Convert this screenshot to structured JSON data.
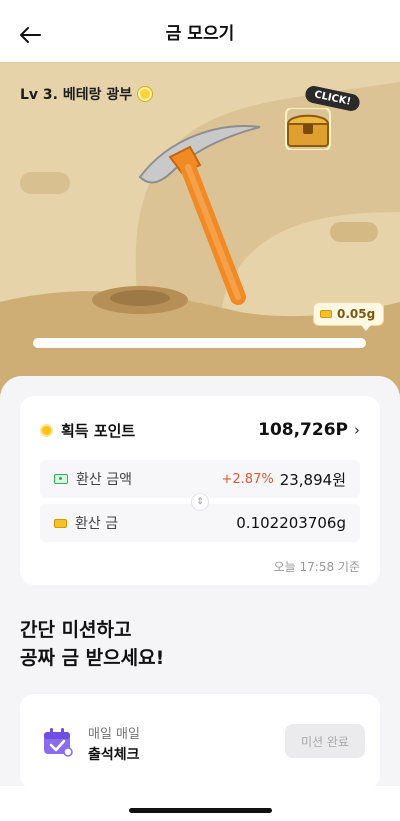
{
  "header": {
    "title": "금 모으기",
    "back_icon": "back-arrow-icon"
  },
  "hero": {
    "level_text": "Lv 3. 베테랑 광부",
    "click_badge": "CLICK!",
    "gold_amount": "0.05g",
    "colors": {
      "sand": "#e6d3aa",
      "path": "#d8bf8c",
      "ground": "#cba86d"
    }
  },
  "points": {
    "label": "획득 포인트",
    "value": "108,726P",
    "exchange": {
      "cash_label": "환산 금액",
      "cash_rate": "+2.87%",
      "cash_value": "23,894원",
      "gold_label": "환산 금",
      "gold_value": "0.102203706g"
    },
    "timestamp": "오늘 17:58 기준"
  },
  "missions": {
    "heading_line1": "간단 미션하고",
    "heading_line2": "공짜 금 받으세요!",
    "items": [
      {
        "subtitle": "매일 매일",
        "title": "출석체크",
        "button": "미션 완료",
        "icon": "calendar-check-icon"
      }
    ]
  }
}
